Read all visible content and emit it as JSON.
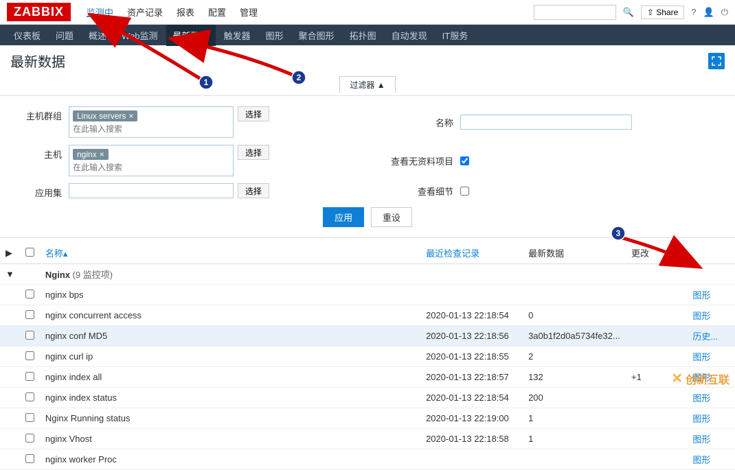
{
  "brand": "ZABBIX",
  "top_menu": [
    "监测中",
    "资产记录",
    "报表",
    "配置",
    "管理"
  ],
  "top_menu_active": 0,
  "top_right": {
    "share": "Share"
  },
  "sub_menu": [
    "仪表板",
    "问题",
    "概述",
    "Web监测",
    "最新数据",
    "触发器",
    "图形",
    "聚合图形",
    "拓扑图",
    "自动发现",
    "IT服务"
  ],
  "sub_menu_active": 4,
  "page_title": "最新数据",
  "filter": {
    "toggle_label": "过滤器",
    "host_group_label": "主机群组",
    "host_group_tag": "Linux servers",
    "host_label": "主机",
    "host_tag": "nginx",
    "placeholder": "在此输入搜索",
    "app_label": "应用集",
    "select_btn": "选择",
    "name_label": "名称",
    "no_data_label": "查看无资料项目",
    "detail_label": "查看细节",
    "apply": "应用",
    "reset": "重设"
  },
  "table": {
    "headers": {
      "name": "名称",
      "check": "最近检查记录",
      "data": "最新数据",
      "change": "更改"
    },
    "group": {
      "name": "Nginx",
      "count": "(9 监控项)"
    },
    "rows": [
      {
        "name": "nginx bps",
        "check": "",
        "data": "",
        "change": "",
        "action": "图形"
      },
      {
        "name": "nginx concurrent access",
        "check": "2020-01-13 22:18:54",
        "data": "0",
        "change": "",
        "action": "图形"
      },
      {
        "name": "nginx conf MD5",
        "check": "2020-01-13 22:18:56",
        "data": "3a0b1f2d0a5734fe32...",
        "change": "",
        "action": "历史...",
        "hl": true
      },
      {
        "name": "nginx curl ip",
        "check": "2020-01-13 22:18:55",
        "data": "2",
        "change": "",
        "action": "图形"
      },
      {
        "name": "nginx index all",
        "check": "2020-01-13 22:18:57",
        "data": "132",
        "change": "+1",
        "action": "图形"
      },
      {
        "name": "nginx index status",
        "check": "2020-01-13 22:18:54",
        "data": "200",
        "change": "",
        "action": "图形"
      },
      {
        "name": "Nginx Running status",
        "check": "2020-01-13 22:19:00",
        "data": "1",
        "change": "",
        "action": "图形"
      },
      {
        "name": "nginx Vhost",
        "check": "2020-01-13 22:18:58",
        "data": "1",
        "change": "",
        "action": "图形"
      },
      {
        "name": "nginx worker Proc",
        "check": "",
        "data": "",
        "change": "",
        "action": "图形"
      }
    ]
  },
  "watermark": "创新互联"
}
